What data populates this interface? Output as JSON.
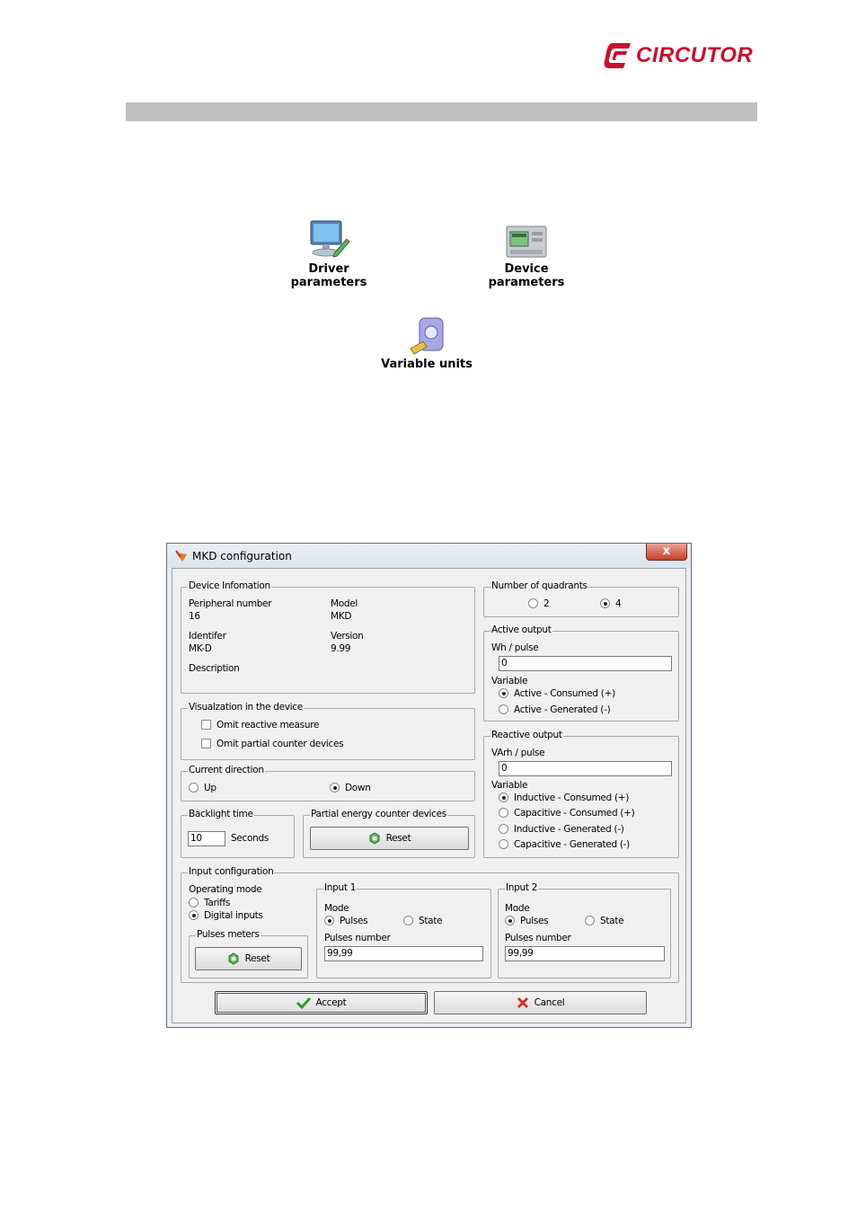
{
  "brand": {
    "name": "CIRCUTOR",
    "color": "#c8102e"
  },
  "icons": [
    {
      "label": "Driver parameters",
      "icon": "monitor-pencil-icon"
    },
    {
      "label": "Device parameters",
      "icon": "device-meter-icon"
    },
    {
      "label": "Variable units",
      "icon": "variable-units-icon"
    }
  ],
  "dialog": {
    "title": "MKD configuration",
    "close_label": "x",
    "device_info": {
      "legend": "Device Infomation",
      "peripheral_label": "Peripheral number",
      "peripheral_value": "16",
      "model_label": "Model",
      "model_value": "MKD",
      "identifier_label": "Identifer",
      "identifier_value": "MK-D",
      "version_label": "Version",
      "version_value": "9.99",
      "description_label": "Description"
    },
    "visualization": {
      "legend": "Visualzation in the device",
      "omit_reactive": "Omit reactive measure",
      "omit_partial": "Omit partial counter devices"
    },
    "current_direction": {
      "legend": "Current direction",
      "up": "Up",
      "down": "Down",
      "selected": "Down"
    },
    "backlight": {
      "legend": "Backlight time",
      "value": "10",
      "unit": "Seconds"
    },
    "partial_energy": {
      "legend": "Partial energy counter devices",
      "reset_label": "Reset"
    },
    "quadrants": {
      "legend": "Number of quadrants",
      "opt1": "2",
      "opt2": "4",
      "selected": "4"
    },
    "active_output": {
      "legend": "Active output",
      "pulse_label": "Wh / pulse",
      "pulse_value": "0",
      "variable_label": "Variable",
      "opt1": "Active - Consumed (+)",
      "opt2": "Active - Generated (-)",
      "selected": "Active - Consumed (+)"
    },
    "reactive_output": {
      "legend": "Reactive output",
      "pulse_label": "VArh / pulse",
      "pulse_value": "0",
      "variable_label": "Variable",
      "opt1": "Inductive - Consumed (+)",
      "opt2": "Capacitive - Consumed (+)",
      "opt3": "Inductive - Generated (-)",
      "opt4": "Capacitive - Generated (-)",
      "selected": "Inductive - Consumed (+)"
    },
    "input_config": {
      "legend": "Input configuration",
      "operating_mode_label": "Operating mode",
      "tariffs": "Tariffs",
      "digital_inputs": "Digital inputs",
      "selected": "Digital inputs",
      "pulses_meters_legend": "Pulses meters",
      "reset_label": "Reset",
      "input1": {
        "legend": "Input 1",
        "mode_label": "Mode",
        "pulses": "Pulses",
        "state": "State",
        "pulses_number_label": "Pulses number",
        "pulses_number_value": "99,99"
      },
      "input2": {
        "legend": "Input 2",
        "mode_label": "Mode",
        "pulses": "Pulses",
        "state": "State",
        "pulses_number_label": "Pulses number",
        "pulses_number_value": "99,99"
      }
    },
    "accept_label": "Accept",
    "cancel_label": "Cancel"
  }
}
